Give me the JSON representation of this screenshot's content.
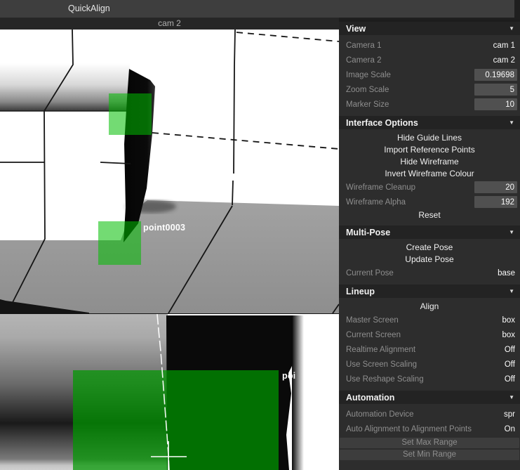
{
  "titlebar": {
    "title": "QuickAlign"
  },
  "viewports": {
    "top": {
      "camera_label": "cam 2",
      "point_label": "point0003"
    },
    "bottom": {
      "point_label": "poi"
    }
  },
  "colors": {
    "marker_green": "#00be00",
    "overlay_green": "#009900",
    "panel_bg": "#2d2d2d",
    "section_header_bg": "#232323",
    "titlebar_bg": "#3e3e3e"
  },
  "panel": {
    "sections": [
      {
        "title": "View",
        "collapse_icon": "▼",
        "items": [
          {
            "type": "field",
            "label": "Camera 1",
            "value": "cam 1"
          },
          {
            "type": "field",
            "label": "Camera 2",
            "value": "cam 2"
          },
          {
            "type": "input",
            "label": "Image Scale",
            "value": "0.19698"
          },
          {
            "type": "input",
            "label": "Zoom Scale",
            "value": "5"
          },
          {
            "type": "input",
            "label": "Marker Size",
            "value": "10"
          }
        ]
      },
      {
        "title": "Interface Options",
        "collapse_icon": "▼",
        "items": [
          {
            "type": "button",
            "label": "Hide Guide Lines"
          },
          {
            "type": "button",
            "label": "Import Reference Points"
          },
          {
            "type": "button",
            "label": "Hide Wireframe"
          },
          {
            "type": "button",
            "label": "Invert Wireframe Colour"
          },
          {
            "type": "input",
            "label": "Wireframe Cleanup",
            "value": "20"
          },
          {
            "type": "input",
            "label": "Wireframe Alpha",
            "value": "192"
          },
          {
            "type": "button",
            "label": "Reset"
          }
        ]
      },
      {
        "title": "Multi-Pose",
        "collapse_icon": "▼",
        "items": [
          {
            "type": "button",
            "label": "Create Pose"
          },
          {
            "type": "button",
            "label": "Update Pose"
          },
          {
            "type": "field",
            "label": "Current Pose",
            "value": "base"
          }
        ]
      },
      {
        "title": "Lineup",
        "collapse_icon": "▼",
        "items": [
          {
            "type": "button",
            "label": "Align"
          },
          {
            "type": "field",
            "label": "Master Screen",
            "value": "box"
          },
          {
            "type": "field",
            "label": "Current Screen",
            "value": "box"
          },
          {
            "type": "field",
            "label": "Realtime Alignment",
            "value": "Off"
          },
          {
            "type": "field",
            "label": "Use Screen Scaling",
            "value": "Off"
          },
          {
            "type": "field",
            "label": "Use Reshape Scaling",
            "value": "Off"
          }
        ]
      },
      {
        "title": "Automation",
        "collapse_icon": "▼",
        "items": [
          {
            "type": "field",
            "label": "Automation Device",
            "value": "spr"
          },
          {
            "type": "field",
            "label": "Auto Alignment to Alignment Points",
            "value": "On"
          },
          {
            "type": "button_disabled",
            "label": "Set Max Range"
          },
          {
            "type": "button_disabled",
            "label": "Set Min Range"
          }
        ]
      }
    ]
  }
}
